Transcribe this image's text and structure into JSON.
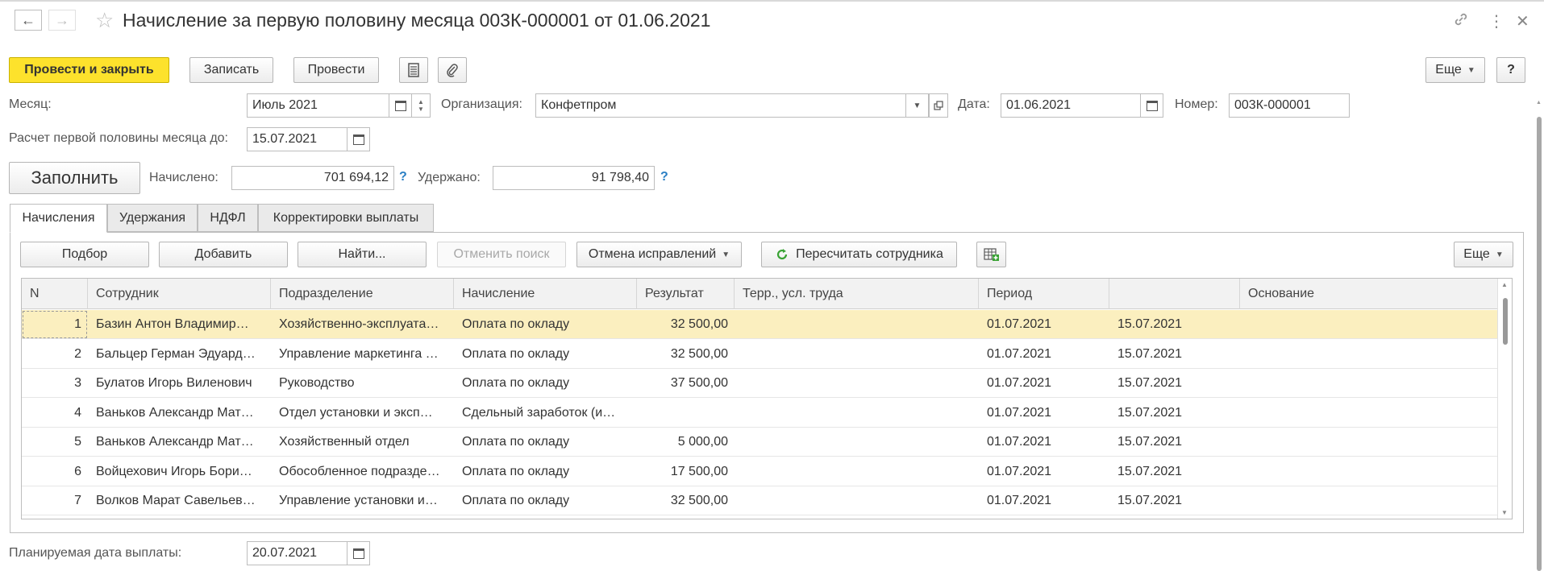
{
  "window": {
    "title": "Начисление за первую половину месяца 003К-000001 от 01.06.2021",
    "back": "←",
    "forward": "→",
    "star": "☆",
    "link": "🔗",
    "more": "⋮",
    "close": "✕"
  },
  "toolbar": {
    "post_close": "Провести и закрыть",
    "save": "Записать",
    "post": "Провести",
    "more": "Еще",
    "help": "?"
  },
  "header": {
    "month_label": "Месяц:",
    "month_value": "Июль 2021",
    "org_label": "Организация:",
    "org_value": "Конфетпром",
    "date_label": "Дата:",
    "date_value": "01.06.2021",
    "number_label": "Номер:",
    "number_value": "003К-000001",
    "calc_until_label": "Расчет первой половины месяца до:",
    "calc_until_value": "15.07.2021",
    "fill_button": "Заполнить",
    "accrued_label": "Начислено:",
    "accrued_value": "701 694,12",
    "withheld_label": "Удержано:",
    "withheld_value": "91 798,40",
    "hint": "?"
  },
  "tabs": [
    {
      "label": "Начисления"
    },
    {
      "label": "Удержания"
    },
    {
      "label": "НДФЛ"
    },
    {
      "label": "Корректировки выплаты"
    }
  ],
  "table_toolbar": {
    "pick": "Подбор",
    "add": "Добавить",
    "find": "Найти...",
    "cancel_search": "Отменить поиск",
    "cancel_fixes": "Отмена исправлений",
    "recalc": "Пересчитать сотрудника",
    "more": "Еще"
  },
  "table": {
    "columns": [
      "N",
      "Сотрудник",
      "Подразделение",
      "Начисление",
      "Результат",
      "Терр., усл. труда",
      "Период",
      "",
      "Основание"
    ],
    "rows": [
      [
        "1",
        "Базин Антон Владимир…",
        "Хозяйственно-эксплуата…",
        "Оплата по окладу",
        "32 500,00",
        "",
        "01.07.2021",
        "15.07.2021",
        ""
      ],
      [
        "2",
        "Бальцер Герман Эдуард…",
        "Управление маркетинга …",
        "Оплата по окладу",
        "32 500,00",
        "",
        "01.07.2021",
        "15.07.2021",
        ""
      ],
      [
        "3",
        "Булатов Игорь Виленович",
        "Руководство",
        "Оплата по окладу",
        "37 500,00",
        "",
        "01.07.2021",
        "15.07.2021",
        ""
      ],
      [
        "4",
        "Ваньков Александр Мат…",
        "Отдел установки и эксп…",
        "Сдельный заработок (и…",
        "",
        "",
        "01.07.2021",
        "15.07.2021",
        ""
      ],
      [
        "5",
        "Ваньков Александр Мат…",
        "Хозяйственный отдел",
        "Оплата по окладу",
        "5 000,00",
        "",
        "01.07.2021",
        "15.07.2021",
        ""
      ],
      [
        "6",
        "Войцехович Игорь Бори…",
        "Обособленное подразде…",
        "Оплата по окладу",
        "17 500,00",
        "",
        "01.07.2021",
        "15.07.2021",
        ""
      ],
      [
        "7",
        "Волков Марат Савельев…",
        "Управление установки и…",
        "Оплата по окладу",
        "32 500,00",
        "",
        "01.07.2021",
        "15.07.2021",
        ""
      ]
    ]
  },
  "footer": {
    "pay_date_label": "Планируемая дата выплаты:",
    "pay_date_value": "20.07.2021"
  }
}
